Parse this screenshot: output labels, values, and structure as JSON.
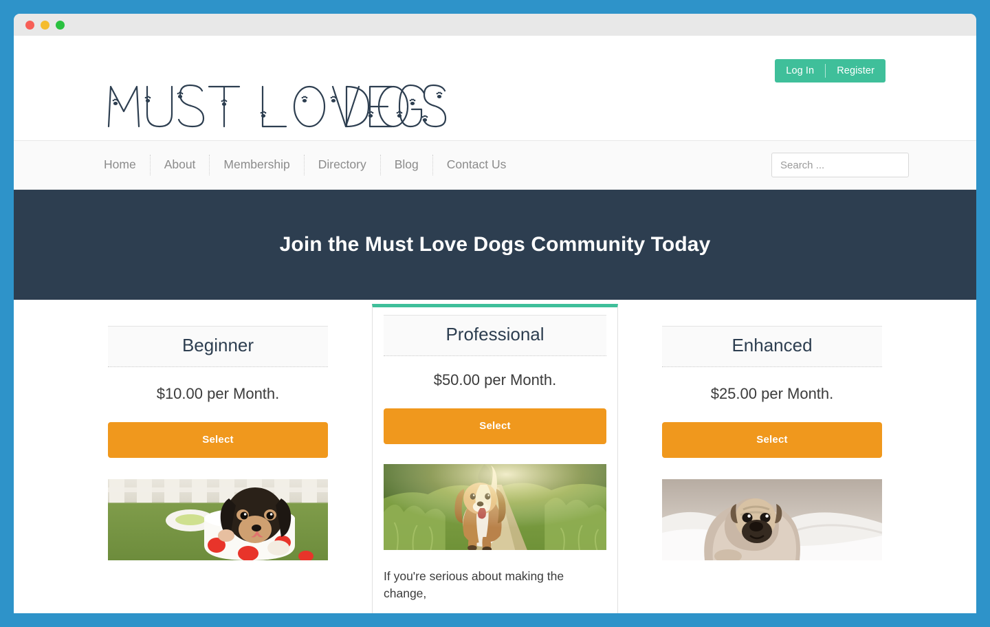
{
  "window": {
    "traffic_lights": [
      "close",
      "minimize",
      "maximize"
    ]
  },
  "header": {
    "logo_text": "MUST LOVE DOGS",
    "auth": {
      "login_label": "Log In",
      "register_label": "Register"
    }
  },
  "nav": {
    "items": [
      {
        "label": "Home"
      },
      {
        "label": "About"
      },
      {
        "label": "Membership"
      },
      {
        "label": "Directory"
      },
      {
        "label": "Blog"
      },
      {
        "label": "Contact Us"
      }
    ],
    "search": {
      "placeholder": "Search ...",
      "value": ""
    }
  },
  "hero": {
    "title": "Join the Must Love Dogs Community Today"
  },
  "pricing": {
    "plans": [
      {
        "name": "Beginner",
        "price": "$10.00 per Month.",
        "button_label": "Select",
        "featured": false,
        "image_alt": "puppy-in-polka-dot-cup-photo",
        "description": ""
      },
      {
        "name": "Professional",
        "price": "$50.00 per Month.",
        "button_label": "Select",
        "featured": true,
        "image_alt": "beagle-running-on-path-photo",
        "description": "If you're serious about making the change,"
      },
      {
        "name": "Enhanced",
        "price": "$25.00 per Month.",
        "button_label": "Select",
        "featured": false,
        "image_alt": "pug-wrapped-in-blanket-photo",
        "description": ""
      }
    ]
  },
  "colors": {
    "page_background": "#2e93c9",
    "titlebar": "#e8e8e8",
    "accent_teal": "#3fbf9a",
    "hero_navy": "#2d3e50",
    "button_orange": "#f0981d",
    "nav_text": "#8b8b8b"
  }
}
